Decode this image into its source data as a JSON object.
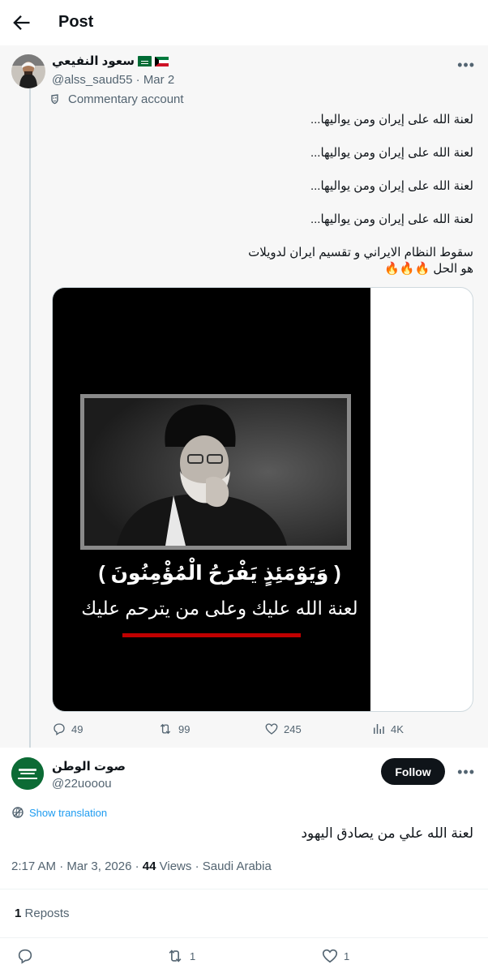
{
  "header": {
    "title": "Post"
  },
  "parent_post": {
    "author_name": "سعود النفيعي",
    "handle": "@alss_saud55",
    "date": "Mar 2",
    "separator": "·",
    "label": "Commentary account",
    "lines": [
      "لعنة الله على إيران ومن يواليها...",
      "لعنة الله على إيران ومن يواليها...",
      "لعنة الله على إيران ومن يواليها...",
      "لعنة الله على إيران ومن يواليها...",
      "سقوط النظام الايراني و تقسيم ايران لدويلات",
      "هو الحل 🔥🔥🔥"
    ],
    "media": {
      "quote": "( وَيَوْمَئِذٍ يَفْرَحُ الْمُؤْمِنُونَ )",
      "curse": "لعنة الله عليك وعلى من يترحم عليك"
    },
    "stats": {
      "replies": "49",
      "reposts": "99",
      "likes": "245",
      "views": "4K"
    },
    "colors": {
      "flag1": "#006c35",
      "flag2": "#007a3d"
    }
  },
  "reply": {
    "author_name": "صوت الوطن",
    "handle": "@22uooou",
    "follow_label": "Follow",
    "translate_label": "Show translation",
    "text": "لعنة الله علي من يصادق اليهود",
    "time": "2:17 AM",
    "date": "Mar 3, 2026",
    "views_count": "44",
    "views_label": "Views",
    "location": "Saudi Arabia",
    "dot": "·",
    "reposts_count": "1",
    "reposts_label": "Reposts",
    "action_reposts": "1",
    "action_likes": "1"
  }
}
